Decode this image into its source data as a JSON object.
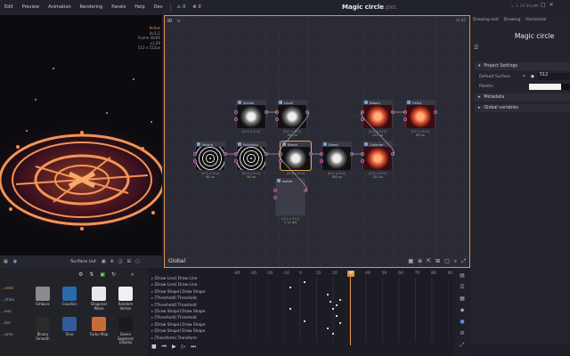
{
  "menu": {
    "items": [
      "Edit",
      "Preview",
      "Animation",
      "Rendering",
      "Panels",
      "Help",
      "Dev"
    ],
    "counter_a": "0",
    "counter_b": "0"
  },
  "window": {
    "title": "Magic circle",
    "title_ext": ".pxc",
    "version": "v. 1.16 Steam"
  },
  "preview": {
    "info_active": "Active",
    "info_lines": [
      "0s/1/2",
      "Frame 40/80",
      "x1.69",
      "512 x 512px"
    ],
    "bottom_select": "Surface out"
  },
  "graph": {
    "zoom": "x0.85",
    "label": "Global",
    "nodes": [
      {
        "name": "Stroke",
        "size": "[512 x 512]",
        "time": ""
      },
      {
        "name": "Level",
        "size": "[512 x 512]",
        "time": "160 us"
      },
      {
        "name": "Bloom",
        "size": "[512 x 512]",
        "time": "221 us"
      },
      {
        "name": "FXAA",
        "size": "[512 x 512]",
        "time": "60 us"
      },
      {
        "name": "Matrix",
        "size": "[512 x 512]",
        "time": "60 us"
      },
      {
        "name": "Polishing",
        "size": "[512 x 512]",
        "time": "90 us"
      },
      {
        "name": "Blend",
        "size": "[512 x 512]",
        "time": ""
      },
      {
        "name": "Blend",
        "size": "[512 x 512]",
        "time": "160 us"
      },
      {
        "name": "Colorize",
        "size": "[512 x 512]",
        "time": "120 us"
      },
      {
        "name": "Isotile",
        "size": "[512 x 512]",
        "time": "1.11 ms"
      }
    ]
  },
  "inspector": {
    "tabs": [
      "Drawing exit",
      "Drawing",
      "Horizontal"
    ],
    "title": "Magic circle",
    "sections": [
      "Project Settings",
      "Metadata",
      "Global variables"
    ],
    "default_surface_label": "Default Surface",
    "default_surface_value": "512",
    "palette_label": "Palette"
  },
  "collection": {
    "categories": [
      "...sred",
      "...ction",
      "...ear",
      "",
      "...tor",
      "...orm"
    ],
    "items": [
      {
        "name": "Emboss",
        "icon": "emboss-icon"
      },
      {
        "name": "Caustics",
        "icon": "caustics-icon"
      },
      {
        "name": "Diagonal Wave",
        "icon": "diagonal-wave-icon"
      },
      {
        "name": "Random Vertex",
        "icon": "random-vertex-icon"
      },
      {
        "name": "Binary Smooth",
        "icon": "binary-smooth-icon"
      },
      {
        "name": "Sine",
        "icon": "sine-icon"
      },
      {
        "name": "Turbo Map",
        "icon": "turbo-map-icon"
      },
      {
        "name": "Seven Segment Display",
        "icon": "seven-segment-icon"
      }
    ]
  },
  "timeline": {
    "tracks": [
      "[Draw Line] Draw Line",
      "[Draw Line] Draw Line",
      "[Draw Shape] Draw Shape",
      "[Threshold] Threshold",
      "[Threshold] Threshold",
      "[Draw Shape] Draw Shape",
      "[Threshold] Threshold",
      "[Draw Shape] Draw Shape",
      "[Draw Shape] Draw Shape",
      "[Transform] Transform"
    ],
    "ticks": [
      "-40",
      "-30",
      "-20",
      "-10",
      "0",
      "10",
      "20",
      "30",
      "40",
      "50",
      "60",
      "70",
      "80",
      "90"
    ],
    "current_frame": "40"
  },
  "colors": {
    "accent": "#d9924a",
    "port": "#c95ea8",
    "time_green": "#7fcf6a"
  }
}
